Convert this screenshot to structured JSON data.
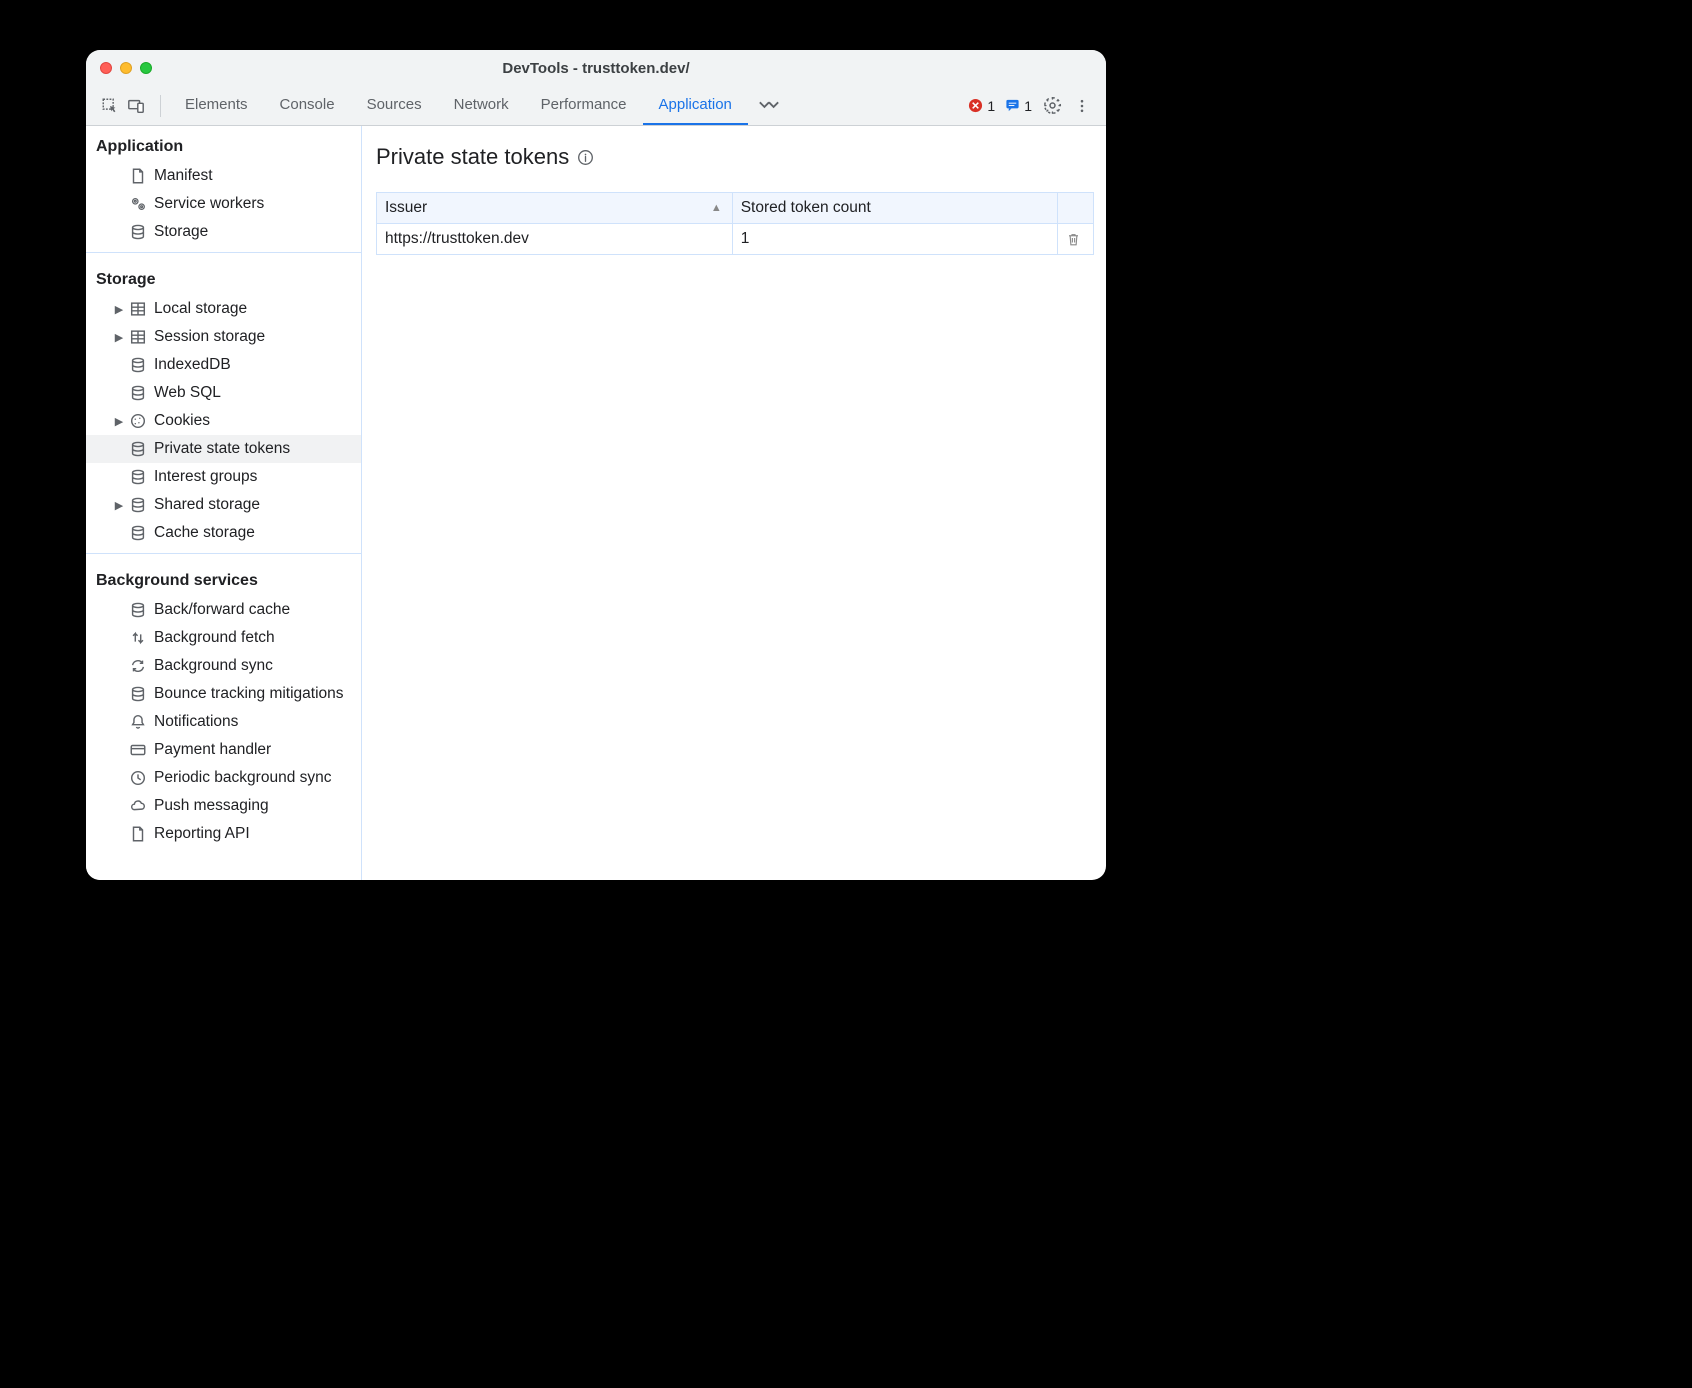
{
  "window": {
    "title": "DevTools - trusttoken.dev/"
  },
  "toolbar": {
    "tabs": [
      "Elements",
      "Console",
      "Sources",
      "Network",
      "Performance",
      "Application"
    ],
    "active_tab": "Application",
    "errors_count": "1",
    "messages_count": "1"
  },
  "sidebar": {
    "sections": [
      {
        "title": "Application",
        "items": [
          {
            "label": "Manifest",
            "icon": "page",
            "expandable": false
          },
          {
            "label": "Service workers",
            "icon": "gears",
            "expandable": false
          },
          {
            "label": "Storage",
            "icon": "db",
            "expandable": false
          }
        ]
      },
      {
        "title": "Storage",
        "items": [
          {
            "label": "Local storage",
            "icon": "table",
            "expandable": true
          },
          {
            "label": "Session storage",
            "icon": "table",
            "expandable": true
          },
          {
            "label": "IndexedDB",
            "icon": "db",
            "expandable": false
          },
          {
            "label": "Web SQL",
            "icon": "db",
            "expandable": false
          },
          {
            "label": "Cookies",
            "icon": "cookie",
            "expandable": true
          },
          {
            "label": "Private state tokens",
            "icon": "db",
            "expandable": false,
            "selected": true
          },
          {
            "label": "Interest groups",
            "icon": "db",
            "expandable": false
          },
          {
            "label": "Shared storage",
            "icon": "db",
            "expandable": true
          },
          {
            "label": "Cache storage",
            "icon": "db",
            "expandable": false
          }
        ]
      },
      {
        "title": "Background services",
        "items": [
          {
            "label": "Back/forward cache",
            "icon": "db",
            "expandable": false
          },
          {
            "label": "Background fetch",
            "icon": "fetch",
            "expandable": false
          },
          {
            "label": "Background sync",
            "icon": "sync",
            "expandable": false
          },
          {
            "label": "Bounce tracking mitigations",
            "icon": "db",
            "expandable": false
          },
          {
            "label": "Notifications",
            "icon": "bell",
            "expandable": false
          },
          {
            "label": "Payment handler",
            "icon": "card",
            "expandable": false
          },
          {
            "label": "Periodic background sync",
            "icon": "clock",
            "expandable": false
          },
          {
            "label": "Push messaging",
            "icon": "cloud",
            "expandable": false
          },
          {
            "label": "Reporting API",
            "icon": "page",
            "expandable": false
          }
        ]
      }
    ]
  },
  "main": {
    "title": "Private state tokens",
    "columns": {
      "issuer": "Issuer",
      "count": "Stored token count"
    },
    "rows": [
      {
        "issuer": "https://trusttoken.dev",
        "count": "1"
      }
    ]
  }
}
